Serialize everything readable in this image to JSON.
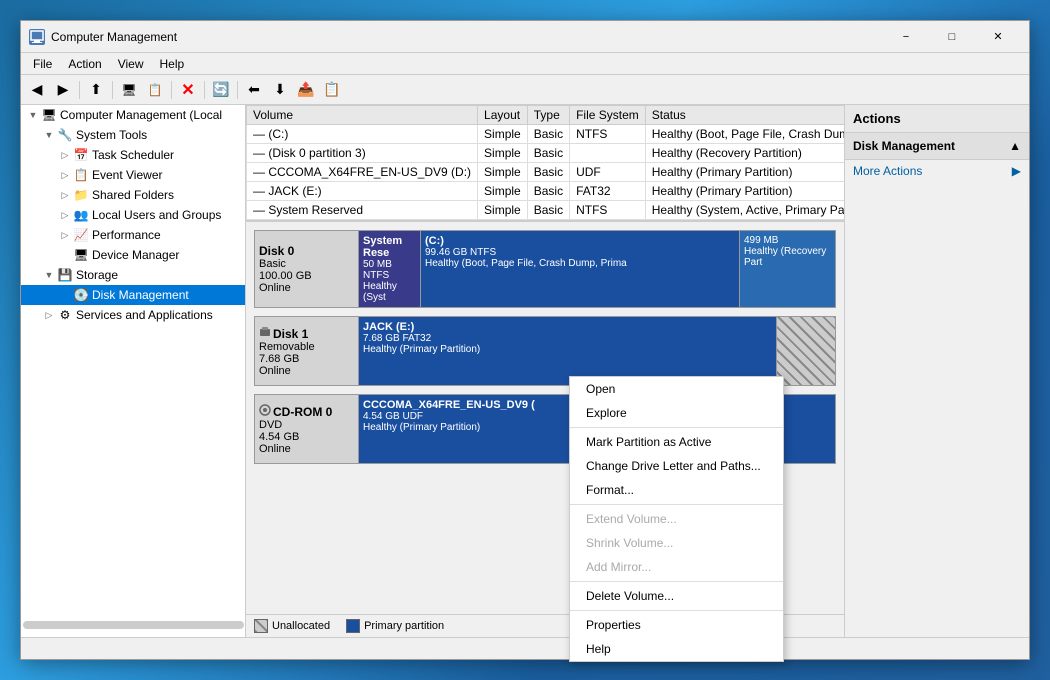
{
  "window": {
    "title": "Computer Management",
    "icon": "⚙"
  },
  "menu": {
    "items": [
      "File",
      "Action",
      "View",
      "Help"
    ]
  },
  "toolbar": {
    "buttons": [
      "◀",
      "▶",
      "⬆",
      "🖥",
      "📋",
      "✖",
      "🔄",
      "⬅",
      "⬇",
      "📤",
      "📋"
    ]
  },
  "sidebar": {
    "items": [
      {
        "label": "Computer Management (Local",
        "level": 0,
        "expand": "▼",
        "icon": "🖥",
        "selected": false
      },
      {
        "label": "System Tools",
        "level": 1,
        "expand": "▼",
        "icon": "🔧",
        "selected": false
      },
      {
        "label": "Task Scheduler",
        "level": 2,
        "expand": "▷",
        "icon": "📅",
        "selected": false
      },
      {
        "label": "Event Viewer",
        "level": 2,
        "expand": "▷",
        "icon": "📋",
        "selected": false
      },
      {
        "label": "Shared Folders",
        "level": 2,
        "expand": "▷",
        "icon": "📁",
        "selected": false
      },
      {
        "label": "Local Users and Groups",
        "level": 2,
        "expand": "▷",
        "icon": "👥",
        "selected": false
      },
      {
        "label": "Performance",
        "level": 2,
        "expand": "▷",
        "icon": "📈",
        "selected": false
      },
      {
        "label": "Device Manager",
        "level": 2,
        "expand": "",
        "icon": "🖥",
        "selected": false
      },
      {
        "label": "Storage",
        "level": 1,
        "expand": "▼",
        "icon": "💾",
        "selected": false
      },
      {
        "label": "Disk Management",
        "level": 2,
        "expand": "",
        "icon": "💽",
        "selected": true
      },
      {
        "label": "Services and Applications",
        "level": 1,
        "expand": "▷",
        "icon": "⚙",
        "selected": false
      }
    ]
  },
  "table": {
    "headers": [
      "Volume",
      "Layout",
      "Type",
      "File System",
      "Status"
    ],
    "rows": [
      {
        "volume": "(C:)",
        "layout": "Simple",
        "type": "Basic",
        "fs": "NTFS",
        "status": "Healthy (Boot, Page File, Crash Dump, P"
      },
      {
        "volume": "(Disk 0 partition 3)",
        "layout": "Simple",
        "type": "Basic",
        "fs": "",
        "status": "Healthy (Recovery Partition)"
      },
      {
        "volume": "CCCOMA_X64FRE_EN-US_DV9 (D:)",
        "layout": "Simple",
        "type": "Basic",
        "fs": "UDF",
        "status": "Healthy (Primary Partition)"
      },
      {
        "volume": "JACK (E:)",
        "layout": "Simple",
        "type": "Basic",
        "fs": "FAT32",
        "status": "Healthy (Primary Partition)"
      },
      {
        "volume": "System Reserved",
        "layout": "Simple",
        "type": "Basic",
        "fs": "NTFS",
        "status": "Healthy (System, Active, Primary Partiti"
      }
    ]
  },
  "disks": [
    {
      "name": "Disk 0",
      "type": "Basic",
      "size": "100.00 GB",
      "status": "Online",
      "partitions": [
        {
          "name": "System Rese",
          "size": "50 MB NTFS",
          "status": "Healthy (Syst",
          "style": "system-reserved",
          "flex": "0 0 60px"
        },
        {
          "name": "(C:)",
          "size": "99.46 GB NTFS",
          "status": "Healthy (Boot, Page File, Crash Dump, Prima",
          "style": "c-drive",
          "flex": "5"
        },
        {
          "name": "",
          "size": "499 MB",
          "status": "Healthy (Recovery Part",
          "style": "recovery",
          "flex": "0 0 100px"
        }
      ]
    },
    {
      "name": "Disk 1",
      "type": "Removable",
      "size": "7.68 GB",
      "status": "Online",
      "partitions": [
        {
          "name": "JACK  (E:)",
          "size": "7.68 GB FAT32",
          "status": "Healthy (Primary Partition)",
          "style": "jack",
          "flex": "3"
        },
        {
          "name": "",
          "size": "",
          "status": "",
          "style": "unallocated",
          "flex": "0 0 60px"
        }
      ]
    },
    {
      "name": "CD-ROM 0",
      "type": "DVD",
      "size": "4.54 GB",
      "status": "Online",
      "partitions": [
        {
          "name": "CCCOMA_X64FRE_EN-US_DV9 (",
          "size": "4.54 GB UDF",
          "status": "Healthy (Primary Partition)",
          "style": "cdrom-content",
          "flex": "1"
        }
      ]
    }
  ],
  "legend": {
    "items": [
      {
        "label": "Unallocated",
        "color": "#888"
      },
      {
        "label": "Primary partition",
        "color": "#1a4fa0"
      }
    ]
  },
  "actions": {
    "panel_title": "Actions",
    "section_label": "Disk Management",
    "more_actions": "More Actions"
  },
  "context_menu": {
    "items": [
      {
        "label": "Open",
        "disabled": false
      },
      {
        "label": "Explore",
        "disabled": false
      },
      {
        "label": "separator1",
        "is_sep": true
      },
      {
        "label": "Mark Partition as Active",
        "disabled": false
      },
      {
        "label": "Change Drive Letter and Paths...",
        "disabled": false
      },
      {
        "label": "Format...",
        "disabled": false
      },
      {
        "label": "separator2",
        "is_sep": true
      },
      {
        "label": "Extend Volume...",
        "disabled": true
      },
      {
        "label": "Shrink Volume...",
        "disabled": true
      },
      {
        "label": "Add Mirror...",
        "disabled": true
      },
      {
        "label": "separator3",
        "is_sep": true
      },
      {
        "label": "Delete Volume...",
        "disabled": false
      },
      {
        "label": "separator4",
        "is_sep": true
      },
      {
        "label": "Properties",
        "disabled": false
      },
      {
        "label": "Help",
        "disabled": false
      }
    ]
  }
}
